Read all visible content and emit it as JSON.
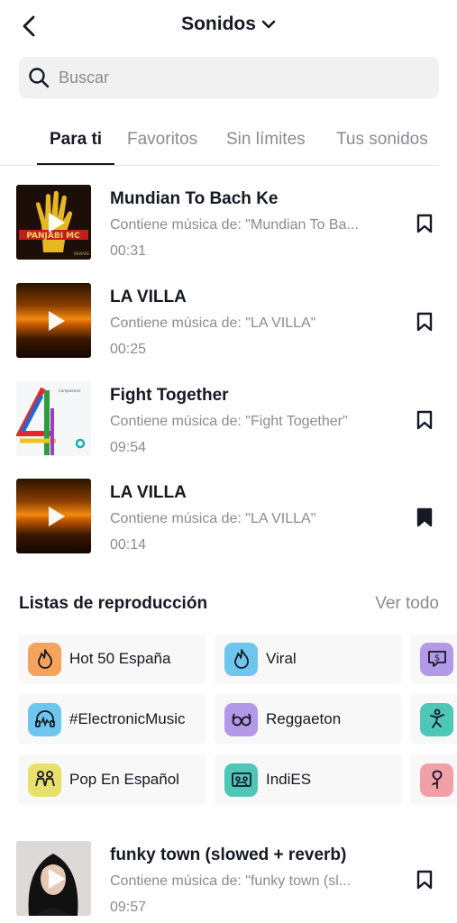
{
  "header": {
    "title": "Sonidos"
  },
  "search": {
    "placeholder": "Buscar",
    "value": ""
  },
  "tabs": [
    {
      "label": "Para ti",
      "active": true
    },
    {
      "label": "Favoritos",
      "active": false
    },
    {
      "label": "Sin límites",
      "active": false
    },
    {
      "label": "Tus sonidos",
      "active": false
    }
  ],
  "tracks": [
    {
      "title": "Mundian To Bach Ke",
      "subtitle": "Contiene música de: \"Mundian To Ba...",
      "duration": "00:31",
      "saved": false
    },
    {
      "title": "LA VILLA",
      "subtitle": "Contiene música de: \"LA VILLA\"",
      "duration": "00:25",
      "saved": false
    },
    {
      "title": "Fight Together",
      "subtitle": "Contiene música de: \"Fight Together\"",
      "duration": "09:54",
      "saved": false
    },
    {
      "title": "LA VILLA",
      "subtitle": "Contiene música de: \"LA VILLA\"",
      "duration": "00:14",
      "saved": true
    },
    {
      "title": "funky town (slowed + reverb)",
      "subtitle": "Contiene música de: \"funky town (sl...",
      "duration": "09:57",
      "saved": false
    }
  ],
  "playlists_section": {
    "title": "Listas de reproducción",
    "see_all": "Ver todo",
    "items": [
      {
        "label": "Hot 50 España",
        "icon": "flame-icon",
        "color": "#f5a25d"
      },
      {
        "label": "Viral",
        "icon": "flame-icon",
        "color": "#6ec6ee"
      },
      {
        "label": "",
        "icon": "money-chat-icon",
        "color": "#b39ae8"
      },
      {
        "label": "#ElectronicMusic",
        "icon": "headphones-icon",
        "color": "#6ec6ee"
      },
      {
        "label": "Reggaeton",
        "icon": "sunglasses-icon",
        "color": "#b39ae8"
      },
      {
        "label": "",
        "icon": "dancer-icon",
        "color": "#4ec7b8"
      },
      {
        "label": "Pop En Español",
        "icon": "people-icon",
        "color": "#e8e06a"
      },
      {
        "label": "IndiES",
        "icon": "cassette-icon",
        "color": "#4ec7b8"
      },
      {
        "label": "",
        "icon": "rose-icon",
        "color": "#f2a0a8"
      }
    ]
  }
}
